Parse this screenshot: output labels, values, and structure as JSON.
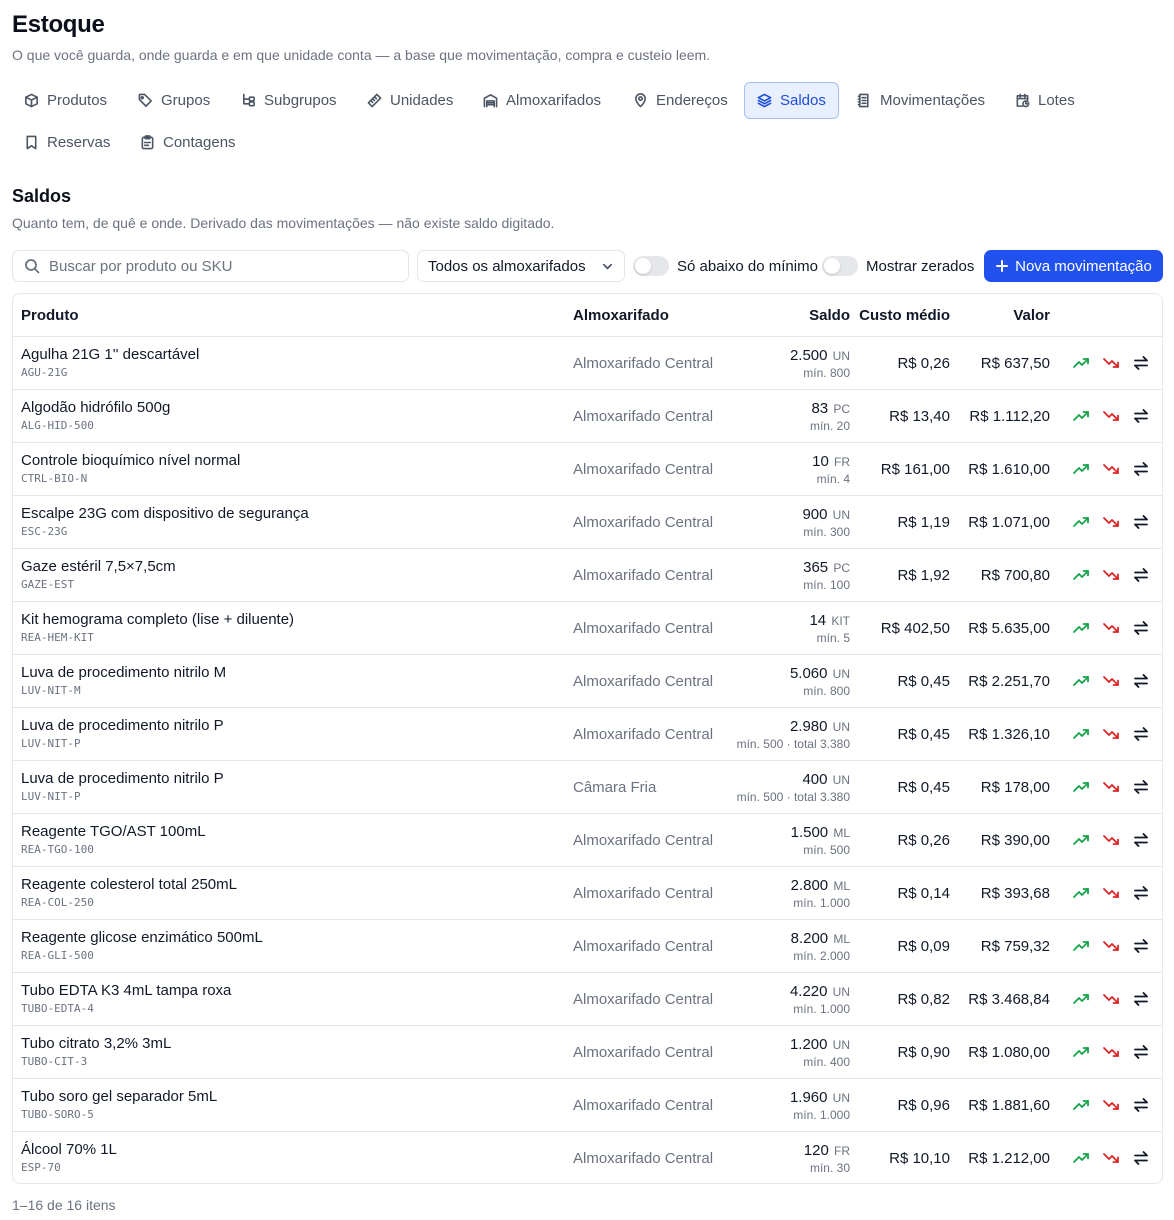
{
  "page": {
    "title": "Estoque",
    "subtitle": "O que você guarda, onde guarda e em que unidade conta — a base que movimentação, compra e custeio leem."
  },
  "tabs": [
    {
      "label": "Produtos",
      "icon": "box-icon"
    },
    {
      "label": "Grupos",
      "icon": "tag-icon"
    },
    {
      "label": "Subgrupos",
      "icon": "hierarchy-icon"
    },
    {
      "label": "Unidades",
      "icon": "ruler-icon"
    },
    {
      "label": "Almoxarifados",
      "icon": "warehouse-icon"
    },
    {
      "label": "Endereços",
      "icon": "map-pin-icon"
    },
    {
      "label": "Saldos",
      "icon": "layers-icon",
      "active": true
    },
    {
      "label": "Movimentações",
      "icon": "ledger-icon"
    },
    {
      "label": "Lotes",
      "icon": "calendar-clock-icon"
    },
    {
      "label": "Reservas",
      "icon": "bookmark-icon"
    },
    {
      "label": "Contagens",
      "icon": "clipboard-icon"
    }
  ],
  "section": {
    "title": "Saldos",
    "subtitle": "Quanto tem, de quê e onde. Derivado das movimentações — não existe saldo digitado."
  },
  "toolbar": {
    "search_placeholder": "Buscar por produto ou SKU",
    "search_value": "",
    "warehouse_filter": "Todos os almoxarifados",
    "toggle_below_min": "Só abaixo do mínimo",
    "toggle_below_min_on": false,
    "toggle_show_zero": "Mostrar zerados",
    "toggle_show_zero_on": false,
    "new_movement": "Nova movimentação"
  },
  "table": {
    "headers": {
      "product": "Produto",
      "warehouse": "Almoxarifado",
      "balance": "Saldo",
      "avg_cost": "Custo médio",
      "value": "Valor"
    },
    "rows": [
      {
        "name": "Agulha 21G 1'' descartável",
        "sku": "AGU-21G",
        "warehouse": "Almoxarifado Central",
        "qty": "2.500",
        "unit": "UN",
        "min": "mín. 800",
        "cost": "R$ 0,26",
        "value": "R$ 637,50"
      },
      {
        "name": "Algodão hidrófilo 500g",
        "sku": "ALG-HID-500",
        "warehouse": "Almoxarifado Central",
        "qty": "83",
        "unit": "PC",
        "min": "mín. 20",
        "cost": "R$ 13,40",
        "value": "R$ 1.112,20"
      },
      {
        "name": "Controle bioquímico nível normal",
        "sku": "CTRL-BIO-N",
        "warehouse": "Almoxarifado Central",
        "qty": "10",
        "unit": "FR",
        "min": "mín. 4",
        "cost": "R$ 161,00",
        "value": "R$ 1.610,00"
      },
      {
        "name": "Escalpe 23G com dispositivo de segurança",
        "sku": "ESC-23G",
        "warehouse": "Almoxarifado Central",
        "qty": "900",
        "unit": "UN",
        "min": "mín. 300",
        "cost": "R$ 1,19",
        "value": "R$ 1.071,00"
      },
      {
        "name": "Gaze estéril 7,5×7,5cm",
        "sku": "GAZE-EST",
        "warehouse": "Almoxarifado Central",
        "qty": "365",
        "unit": "PC",
        "min": "mín. 100",
        "cost": "R$ 1,92",
        "value": "R$ 700,80"
      },
      {
        "name": "Kit hemograma completo (lise + diluente)",
        "sku": "REA-HEM-KIT",
        "warehouse": "Almoxarifado Central",
        "qty": "14",
        "unit": "KIT",
        "min": "mín. 5",
        "cost": "R$ 402,50",
        "value": "R$ 5.635,00"
      },
      {
        "name": "Luva de procedimento nitrilo M",
        "sku": "LUV-NIT-M",
        "warehouse": "Almoxarifado Central",
        "qty": "5.060",
        "unit": "UN",
        "min": "mín. 800",
        "cost": "R$ 0,45",
        "value": "R$ 2.251,70"
      },
      {
        "name": "Luva de procedimento nitrilo P",
        "sku": "LUV-NIT-P",
        "warehouse": "Almoxarifado Central",
        "qty": "2.980",
        "unit": "UN",
        "min": "mín. 500 · total 3.380",
        "cost": "R$ 0,45",
        "value": "R$ 1.326,10"
      },
      {
        "name": "Luva de procedimento nitrilo P",
        "sku": "LUV-NIT-P",
        "warehouse": "Câmara Fria",
        "qty": "400",
        "unit": "UN",
        "min": "mín. 500 · total 3.380",
        "cost": "R$ 0,45",
        "value": "R$ 178,00"
      },
      {
        "name": "Reagente TGO/AST 100mL",
        "sku": "REA-TGO-100",
        "warehouse": "Almoxarifado Central",
        "qty": "1.500",
        "unit": "ML",
        "min": "mín. 500",
        "cost": "R$ 0,26",
        "value": "R$ 390,00"
      },
      {
        "name": "Reagente colesterol total 250mL",
        "sku": "REA-COL-250",
        "warehouse": "Almoxarifado Central",
        "qty": "2.800",
        "unit": "ML",
        "min": "mín. 1.000",
        "cost": "R$ 0,14",
        "value": "R$ 393,68"
      },
      {
        "name": "Reagente glicose enzimático 500mL",
        "sku": "REA-GLI-500",
        "warehouse": "Almoxarifado Central",
        "qty": "8.200",
        "unit": "ML",
        "min": "mín. 2.000",
        "cost": "R$ 0,09",
        "value": "R$ 759,32"
      },
      {
        "name": "Tubo EDTA K3 4mL tampa roxa",
        "sku": "TUBO-EDTA-4",
        "warehouse": "Almoxarifado Central",
        "qty": "4.220",
        "unit": "UN",
        "min": "mín. 1.000",
        "cost": "R$ 0,82",
        "value": "R$ 3.468,84"
      },
      {
        "name": "Tubo citrato 3,2% 3mL",
        "sku": "TUBO-CIT-3",
        "warehouse": "Almoxarifado Central",
        "qty": "1.200",
        "unit": "UN",
        "min": "mín. 400",
        "cost": "R$ 0,90",
        "value": "R$ 1.080,00"
      },
      {
        "name": "Tubo soro gel separador 5mL",
        "sku": "TUBO-SORO-5",
        "warehouse": "Almoxarifado Central",
        "qty": "1.960",
        "unit": "UN",
        "min": "mín. 1.000",
        "cost": "R$ 0,96",
        "value": "R$ 1.881,60"
      },
      {
        "name": "Álcool 70% 1L",
        "sku": "ESP-70",
        "warehouse": "Almoxarifado Central",
        "qty": "120",
        "unit": "FR",
        "min": "mín. 30",
        "cost": "R$ 10,10",
        "value": "R$ 1.212,00"
      }
    ],
    "row_actions": [
      "trending-up-icon",
      "trending-down-icon",
      "transfer-arrows-icon"
    ]
  },
  "footer": {
    "range": "1–16 de 16 itens"
  },
  "colors": {
    "accent": "#2152f0",
    "active_tab_bg": "#e8efff",
    "entry_icon": "#16a34a",
    "exit_icon": "#dc2626"
  }
}
